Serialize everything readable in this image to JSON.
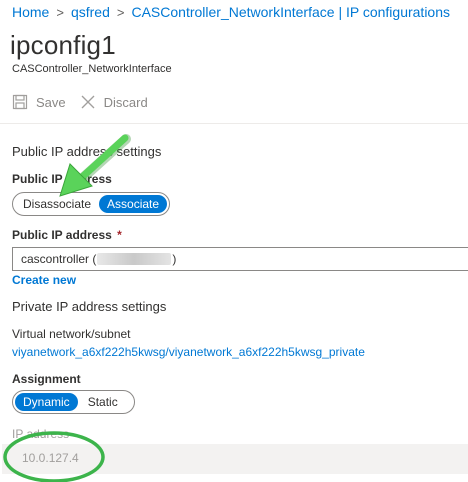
{
  "breadcrumb": [
    "Home",
    "qsfred",
    "CASController_NetworkInterface | IP configurations"
  ],
  "breadcrumb_separator": ">",
  "title": "ipconfig1",
  "subtitle": "CASController_NetworkInterface",
  "toolbar": {
    "save_label": "Save",
    "discard_label": "Discard"
  },
  "public_ip_settings": {
    "heading": "Public IP address settings",
    "toggle_label": "Public IP address",
    "options": [
      "Disassociate",
      "Associate"
    ],
    "selected": "Associate",
    "address_label": "Public IP address",
    "required_marker": "*",
    "address_value_prefix": "cascontroller (",
    "address_value_suffix": ")",
    "create_new_label": "Create new"
  },
  "private_ip_settings": {
    "heading": "Private IP address settings",
    "vnet_label": "Virtual network/subnet",
    "vnet_value": "viyanetwork_a6xf222h5kwsg/viyanetwork_a6xf222h5kwsg_private",
    "assignment_label": "Assignment",
    "assignment_options": [
      "Dynamic",
      "Static"
    ],
    "assignment_selected": "Dynamic",
    "ip_label": "IP address",
    "ip_value": "10.0.127.4"
  },
  "colors": {
    "accent": "#0078d4",
    "annotation_green": "#3cb44b",
    "annotation_arrow": "#5ad35a"
  },
  "icons": {
    "save": "save-icon",
    "discard": "close-icon"
  }
}
